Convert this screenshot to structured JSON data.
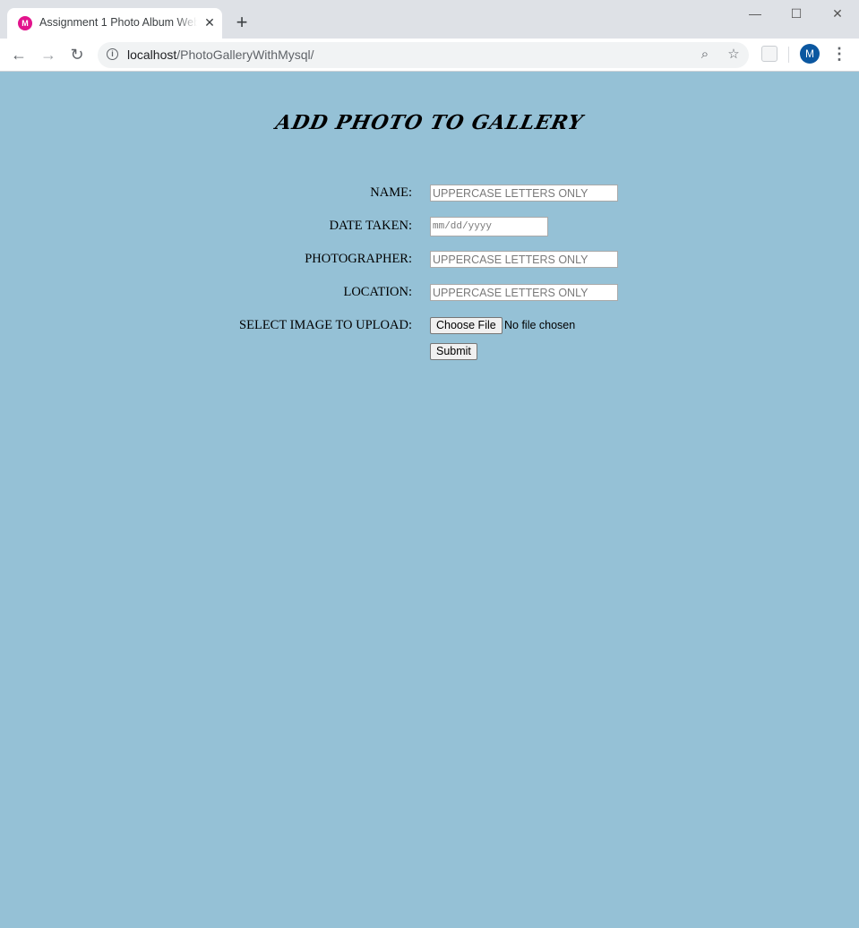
{
  "browser": {
    "tab_title": "Assignment 1 Photo Album Web",
    "tab_favicon_text": "M",
    "url_host": "localhost",
    "url_path": "/PhotoGalleryWithMysql/",
    "avatar_letter": "M",
    "colors": {
      "favicon": "#e2138c",
      "avatar": "#0b57a0",
      "page_bg": "#95c1d6"
    }
  },
  "page": {
    "title": "ADD PHOTO TO GALLERY",
    "form": {
      "name_label": "NAME:",
      "name_placeholder": "UPPERCASE LETTERS ONLY",
      "date_label": "DATE TAKEN:",
      "date_placeholder": "mm/dd/yyyy",
      "photographer_label": "PHOTOGRAPHER:",
      "photographer_placeholder": "UPPERCASE LETTERS ONLY",
      "location_label": "LOCATION:",
      "location_placeholder": "UPPERCASE LETTERS ONLY",
      "upload_label": "SELECT IMAGE TO UPLOAD:",
      "choose_file_label": "Choose File",
      "file_status": "No file chosen",
      "submit_label": "Submit"
    }
  }
}
